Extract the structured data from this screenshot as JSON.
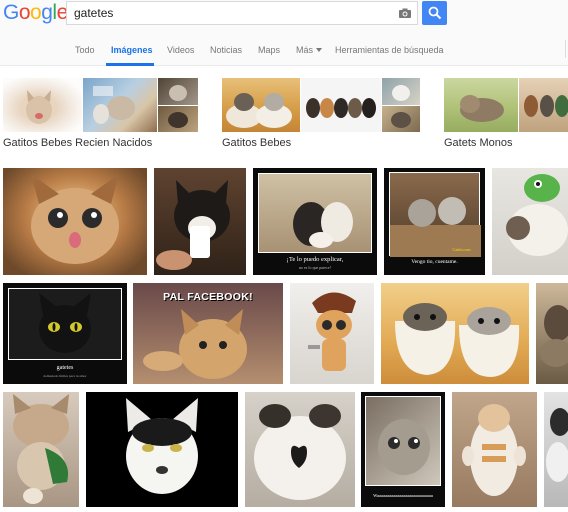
{
  "header": {
    "logo": [
      "G",
      "o",
      "o",
      "g",
      "l",
      "e"
    ],
    "logo_colors": [
      "#4285f4",
      "#ea4335",
      "#fbbc05",
      "#4285f4",
      "#34a853",
      "#ea4335"
    ],
    "query": "gatetes",
    "camera_icon": "camera-icon",
    "search_icon": "search-icon"
  },
  "nav": {
    "items": [
      "Todo",
      "Imágenes",
      "Videos",
      "Noticias",
      "Maps",
      "Más",
      "Herramientas de búsqueda"
    ],
    "active": "Imágenes"
  },
  "related": [
    {
      "label": "Gatitos Bebes Recien Nacidos"
    },
    {
      "label": "Gatitos Bebes"
    },
    {
      "label": "Gatets Monos"
    }
  ],
  "captions": {
    "r1_c3": "¡Te lo puedo explicar,",
    "r1_c3_sub": "no es lo que parece!",
    "r1_c4": "Vengo tio, cuentame.",
    "r1_c4_site": "Catifu.com",
    "r2_c1": "gatetes",
    "r2_c1_sub": "demasiado fútiles para tu amor",
    "r2_c2": "PAL FACEBOOK!",
    "r3_c4": "Waaaaaaaaaaaaaaaaaaaaaaaaaaaa"
  },
  "colors": {
    "accent": "#1a73e8",
    "search_button": "#4285f4"
  }
}
